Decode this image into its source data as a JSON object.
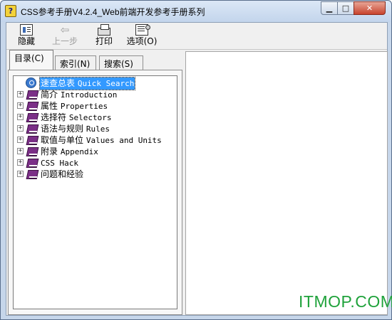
{
  "window": {
    "title": "CSS参考手册V4.2.4_Web前端开发参考手册系列",
    "app_icon": "?",
    "controls": {
      "minimize": "▁",
      "maximize": "□",
      "close": "✕"
    }
  },
  "toolbar": {
    "hide_label": "隐藏",
    "back_label": "上一步",
    "print_label": "打印",
    "options_label": "选项(O)"
  },
  "tabs": [
    {
      "label": "目录(C)",
      "active": true
    },
    {
      "label": "索引(N)",
      "active": false
    },
    {
      "label": "搜索(S)",
      "active": false
    }
  ],
  "tree": {
    "nodes": [
      {
        "zh": "速查总表",
        "en": "Quick Search",
        "icon": "quick-search-icon",
        "selected": true,
        "expandable": false
      },
      {
        "zh": "简介",
        "en": "Introduction",
        "icon": "book-icon",
        "expandable": true
      },
      {
        "zh": "属性",
        "en": "Properties",
        "icon": "book-icon",
        "expandable": true
      },
      {
        "zh": "选择符",
        "en": "Selectors",
        "icon": "book-icon",
        "expandable": true
      },
      {
        "zh": "语法与规则",
        "en": "Rules",
        "icon": "book-icon",
        "expandable": true
      },
      {
        "zh": "取值与单位",
        "en": "Values and Units",
        "icon": "book-icon",
        "expandable": true
      },
      {
        "zh": "附录",
        "en": "Appendix",
        "icon": "book-icon",
        "expandable": true
      },
      {
        "zh": "CSS Hack",
        "en": "",
        "icon": "book-icon",
        "expandable": true
      },
      {
        "zh": "问题和经验",
        "en": "",
        "icon": "book-icon",
        "expandable": true
      }
    ],
    "expander_glyph": "+"
  },
  "watermark": "ITMOP.COM",
  "colors": {
    "selection": "#3399ff",
    "book": "#7b2f87",
    "watermark": "#1fa23b"
  }
}
